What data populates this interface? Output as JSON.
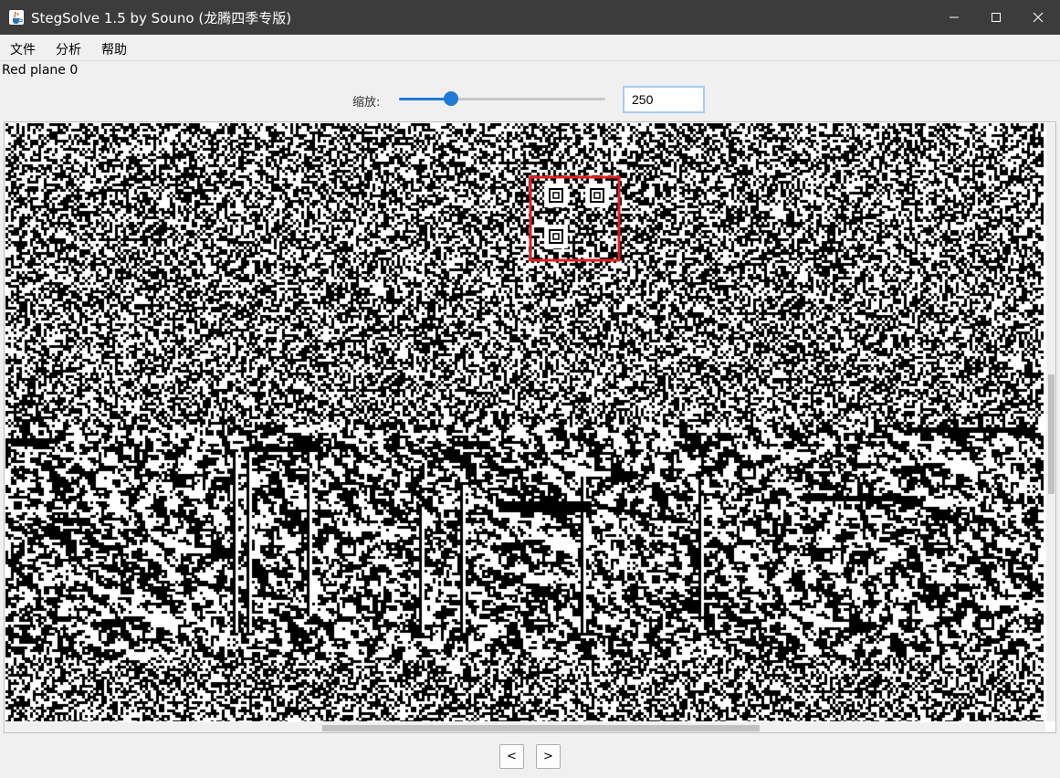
{
  "window": {
    "title": "StegSolve 1.5 by Souno (龙腾四季专版)",
    "app_icon": "java-cup-icon",
    "controls": [
      "minimize-icon",
      "maximize-icon",
      "close-icon"
    ]
  },
  "menu": {
    "items": [
      {
        "label": "文件"
      },
      {
        "label": "分析"
      },
      {
        "label": "帮助"
      }
    ]
  },
  "plane_label": "Red plane 0",
  "zoom": {
    "label": "缩放:",
    "value": "250",
    "slider_fraction": 0.25
  },
  "viewer": {
    "content": "noise-bitplane-image",
    "highlight_color": "#e02020",
    "vertical_scroll": {
      "position": 0.52,
      "size": 0.2
    },
    "horizontal_scroll": {
      "position": 0.305,
      "size": 0.42
    }
  },
  "nav": {
    "prev_label": "<",
    "next_label": ">"
  }
}
